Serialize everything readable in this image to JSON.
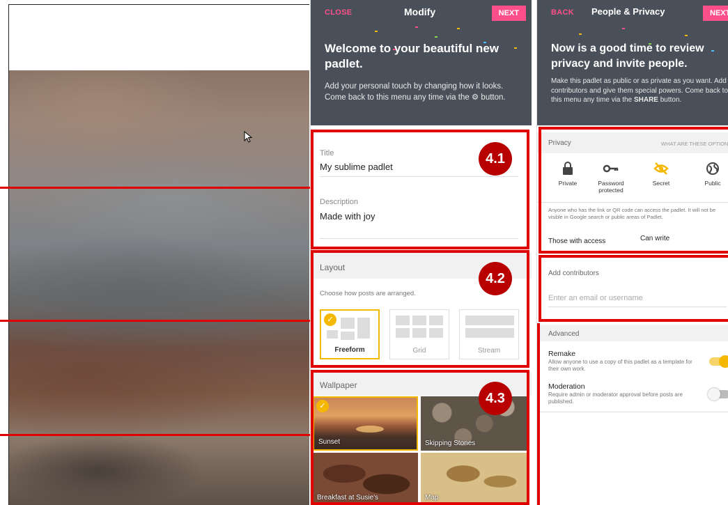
{
  "modify": {
    "close_label": "CLOSE",
    "title": "Modify",
    "next_label": "NEXT",
    "welcome_heading": "Welcome to your beautiful new padlet.",
    "welcome_text": "Add your personal touch by changing how it looks. Come back to this menu any time via the ⚙ button.",
    "title_label": "Title",
    "title_value": "My sublime padlet",
    "description_label": "Description",
    "description_value": "Made with joy",
    "layout_heading": "Layout",
    "layout_hint": "Choose how posts are arranged.",
    "layouts": [
      {
        "label": "Freeform",
        "selected": true
      },
      {
        "label": "Grid",
        "selected": false
      },
      {
        "label": "Stream",
        "selected": false
      }
    ],
    "wallpaper_heading": "Wallpaper",
    "wallpapers": [
      {
        "label": "Sunset",
        "selected": true
      },
      {
        "label": "Skipping Stones",
        "selected": false
      },
      {
        "label": "Breakfast at Susie's",
        "selected": false
      },
      {
        "label": "Map",
        "selected": false
      }
    ]
  },
  "privacy": {
    "back_label": "BACK",
    "title": "People & Privacy",
    "next_label": "NEXT",
    "welcome_heading": "Now is a good time to review privacy and invite people.",
    "welcome_text_1": "Make this padlet as public or as private as you want. Add contributors and give them special powers. Come back to this menu any time via the",
    "welcome_text_share": "SHARE",
    "welcome_text_2": "button.",
    "privacy_heading": "Privacy",
    "options_link": "WHAT ARE THESE OPTIONS",
    "options": [
      {
        "label": "Private",
        "icon": "lock-icon"
      },
      {
        "label": "Password protected",
        "icon": "key-icon"
      },
      {
        "label": "Secret",
        "icon": "eye-off-icon",
        "selected": true
      },
      {
        "label": "Public",
        "icon": "globe-icon"
      }
    ],
    "secret_desc": "Anyone who has the link or QR code can access the padlet. It will not be visible in Google search or public areas of Padlet.",
    "access_label": "Those with access",
    "access_value": "Can write",
    "contributors_heading": "Add contributors",
    "contributors_placeholder": "Enter an email or username",
    "advanced_heading": "Advanced",
    "remake_title": "Remake",
    "remake_desc": "Allow anyone to use a copy of this padlet as a template for their own work.",
    "remake_on": true,
    "moderation_title": "Moderation",
    "moderation_desc": "Require admin or moderator approval before posts are published.",
    "moderation_on": false
  },
  "badges": [
    "4.1",
    "4.2",
    "4.3"
  ],
  "colors": {
    "accent": "#ff4f8b",
    "annotation": "#e00000",
    "badge": "#b80000",
    "selected": "#f5b800",
    "header": "#4a5059"
  }
}
